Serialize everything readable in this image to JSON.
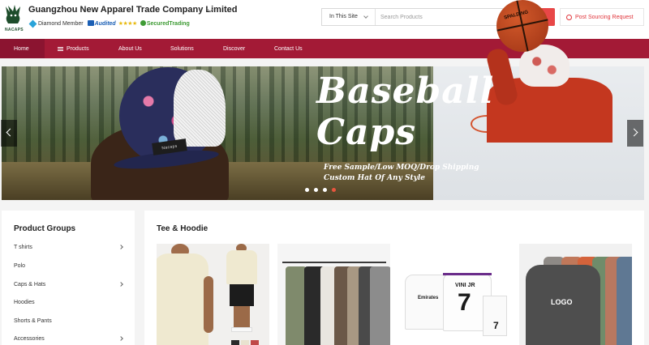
{
  "header": {
    "logo_text": "NACAPS",
    "company_name": "Guangzhou New Apparel Trade Company Limited",
    "badges": {
      "diamond_member": "Diamond Member",
      "audited": "Audited",
      "stars": "★★★★",
      "secured_trading": "SecuredTrading"
    },
    "search": {
      "scope": "In This Site",
      "placeholder": "Search Products"
    },
    "post_sourcing_label": "Post Sourcing Request"
  },
  "nav": {
    "items": [
      "Home",
      "Products",
      "About Us",
      "Solutions",
      "Discover",
      "Contact Us"
    ],
    "active": "Home"
  },
  "banner": {
    "headline_line1": "Baseball",
    "headline_line2": "Caps",
    "subline1": "Free Sample/Low MOQ/Drop Shipping",
    "subline2": "Custom Hat Of Any Style",
    "cap_patch_text": "Nacaps",
    "ball_text": "SPALDING",
    "slide_count": 4,
    "active_slide": 4
  },
  "sidebar": {
    "title": "Product Groups",
    "items": [
      {
        "label": "T shirts",
        "has_children": true
      },
      {
        "label": "Polo",
        "has_children": false
      },
      {
        "label": "Caps & Hats",
        "has_children": true
      },
      {
        "label": "Hoodies",
        "has_children": false
      },
      {
        "label": "Shorts & Pants",
        "has_children": false
      },
      {
        "label": "Accessories",
        "has_children": true
      }
    ]
  },
  "main": {
    "title": "Tee & Hoodie",
    "product_images": [
      {
        "name": "oversized-tee-photo"
      },
      {
        "name": "tee-rack-photo"
      },
      {
        "brand_text": "Emirates",
        "name_text": "VINI JR",
        "number_text": "7",
        "name": "football-jersey-photo"
      },
      {
        "logo_text": "LOGO",
        "name": "washed-tee-photo"
      }
    ]
  },
  "colors": {
    "nav_bg": "#a31a36",
    "accent_red": "#e84747",
    "post_sourcing": "#e0353b"
  }
}
